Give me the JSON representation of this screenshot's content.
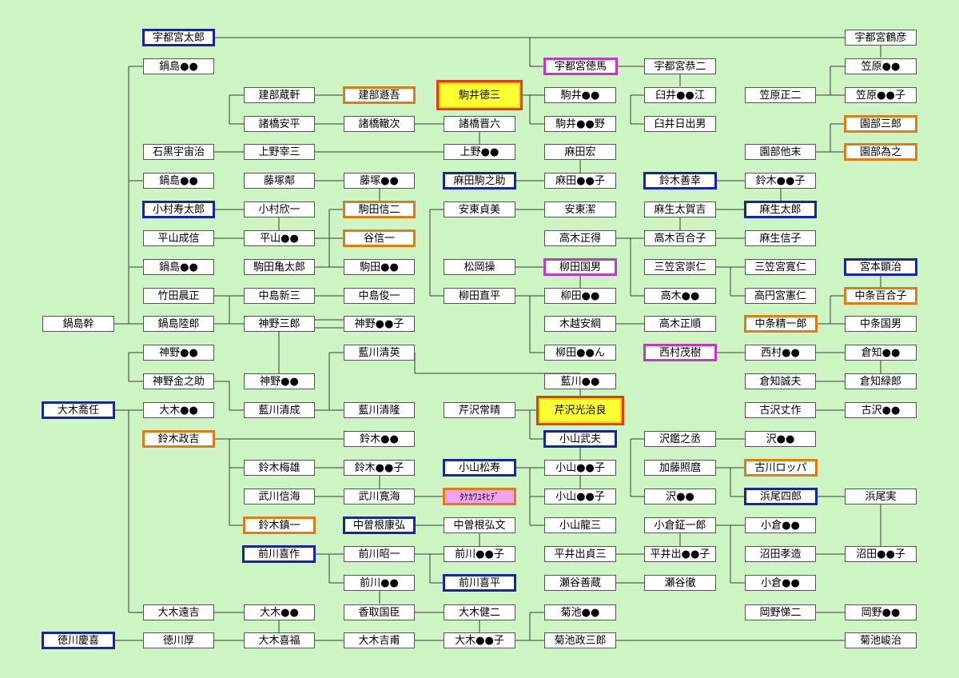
{
  "people": {
    "utsunomiya_taro": "宇都宮太郎",
    "utsunomiya_tsuruhiko": "宇都宮鶴彦",
    "nabeshima_1": "鍋島●●",
    "utsunomiya_tokuma": "宇都宮徳馬",
    "utsunomiya_kyoji": "宇都宮恭二",
    "kasahara_1": "笠原●●",
    "tatebe_zoken": "建部蔵軒",
    "tatebe_tongo": "建部遯吾",
    "komai_tokuzo": "駒井徳三",
    "komai_2": "駒井●●",
    "usui_1": "臼井●●江",
    "kasahara_shoji": "笠原正二",
    "kasahara_2": "笠原●●子",
    "morohashi_anpei": "諸橋安平",
    "morohashi_tetsuji": "諸橋轍次",
    "morohashi_shinroku": "諸橋晋六",
    "komai_3": "駒井●●野",
    "usui_hideo": "臼井日出男",
    "sonobe_saburo": "園部三郎",
    "ishiguro_uchuji": "石黒宇宙治",
    "ueno_saizo": "上野宰三",
    "ueno_2": "上野●●",
    "asada_hiroshi": "麻田宏",
    "sonobe_tasue": "園部他末",
    "sonobe_tameyuki": "園部為之",
    "nabeshima_2": "鍋島●●",
    "fujitsuka_rin": "藤塚鄰",
    "fujitsuka_2": "藤塚●●",
    "asada_komanosuke": "麻田駒之助",
    "asada_2": "麻田●●子",
    "suzuki_zenko": "鈴木善幸",
    "suzuki_2": "鈴木●●子",
    "komura_jutaro": "小村寿太郎",
    "komura_kinichi": "小村欣一",
    "komada_shinji": "駒田信二",
    "ando_sadami": "安東貞美",
    "ando_kiyoshi": "安東潔",
    "aso_takakichi": "麻生太賀吉",
    "aso_taro": "麻生太郎",
    "hirayama_shigenobu": "平山成信",
    "hirayama_2": "平山●●",
    "tani_shinichi": "谷信一",
    "takagi_masae": "高木正得",
    "takagi_yuriko": "高木百合子",
    "aso_nobuko": "麻生信子",
    "nabeshima_3": "鍋島●●",
    "komada_kametaro": "駒田亀太郎",
    "komada_2": "駒田●●",
    "matsuoka_misao": "松岡操",
    "yanagita_kunio": "柳田国男",
    "mikasanomiya_takahito": "三笠宮崇仁",
    "mikasanomiya_tomohito": "三笠宮寛仁",
    "miyamoto_kenji": "宮本顕治",
    "takeda_akimasa": "竹田晨正",
    "nakajima_shinzo": "中島新三",
    "nakajima_shunichi": "中島俊一",
    "yanagita_naohira": "柳田直平",
    "yanagita_2": "柳田●●",
    "takagi_2": "高木●●",
    "takamado_norihito": "高円宮憲仁",
    "chujo_yuriko": "中条百合子",
    "nabeshima_kan": "鍋島幹",
    "nabeshima_rikuro": "鍋島陸郎",
    "kamino_saburo": "神野三郎",
    "kamino_2": "神野●●子",
    "kigoshi_yasutsuna": "木越安綱",
    "takagi_masayori": "高木正順",
    "chujo_seiichiro": "中条精一郎",
    "chujo_kunio": "中条国男",
    "kamino_1": "神野●●",
    "aikawa_kiyohide": "藍川清英",
    "yanagita_3": "柳田●●ん",
    "nishimura_shigeki": "西村茂樹",
    "nishimura_2": "西村●●",
    "kurachi_1": "倉知●●",
    "kamino_kinnosuke": "神野金之助",
    "kamino_3": "神野●●",
    "aikawa_2": "藍川●●",
    "kurachi_seifu": "倉知誠夫",
    "kurachi_rokuro": "倉知緑郎",
    "oki_takato": "大木喬任",
    "oki_1": "大木●●",
    "aikawa_kiyonari": "藍川清成",
    "aikawa_kiyotaka": "藍川清隆",
    "serizawa_tsuneharu": "芹沢常晴",
    "serizawa_kojiro": "芹沢光治良",
    "furusawa_bunsaku": "古沢丈作",
    "furusawa_2": "古沢●●",
    "suzuki_masakichi": "鈴木政吉",
    "suzuki_3": "鈴木●●",
    "koyama_takeo": "小山武夫",
    "sawa_kannojo": "沢鑑之丞",
    "sawa_2": "沢●●",
    "suzuki_umeo": "鈴木梅雄",
    "suzuki_4": "鈴木●●子",
    "koyama_matsuju": "小山松寿",
    "koyama_2": "小山●●子",
    "kato_terumaro": "加藤照麿",
    "furukawa_roppa": "古川ロッパ",
    "takekawa_nobumi": "武川信海",
    "takekawa_kankai": "武川寛海",
    "takekawa_yukihide": "ﾀｹｶﾜﾕｷﾋﾃﾞ",
    "koyama_3": "小山●●子",
    "sawa_3": "沢●●",
    "hamao_shiro": "浜尾四郎",
    "hamao_minoru": "浜尾実",
    "suzuki_chinichi": "鈴木鎮一",
    "nakasone_yasuhiro": "中曽根康弘",
    "nakasone_hirofumi": "中曽根弘文",
    "koyama_ryuzo": "小山龍三",
    "ogura_shoichiro": "小倉鉦一郎",
    "ogura_2": "小倉●●",
    "maekawa_kisaku": "前川喜作",
    "maekawa_shoichi": "前川昭一",
    "maekawa_2": "前川●●子",
    "hirai_detezo": "平井出貞三",
    "hirai_2": "平井出●●子",
    "numata_takazo": "沼田孝造",
    "numata_3": "沼田●●子",
    "maekawa_3": "前川●●",
    "maekawa_kihei": "前川喜平",
    "seya_zenzo": "瀬谷善蔵",
    "seya_toru": "瀬谷徹",
    "ogura_3": "小倉●●",
    "oki_enkichi": "大木遠吉",
    "oki_2": "大木●●",
    "katori_kunitomi": "香取国臣",
    "oki_kenji": "大木健二",
    "kikuchi_1": "菊池●●",
    "okano_teiji": "岡野悌二",
    "okano_2": "岡野●●",
    "tokugawa_yoshinobu": "徳川慶喜",
    "tokugawa_atsushi": "徳川厚",
    "oki_kifuku": "大木喜福",
    "oki_yoshisuke": "大木吉甫",
    "oki_3": "大木●●子",
    "kikuchi_masasaburo": "菊池政三郎",
    "kikuchi_shunji": "菊池峻治"
  }
}
